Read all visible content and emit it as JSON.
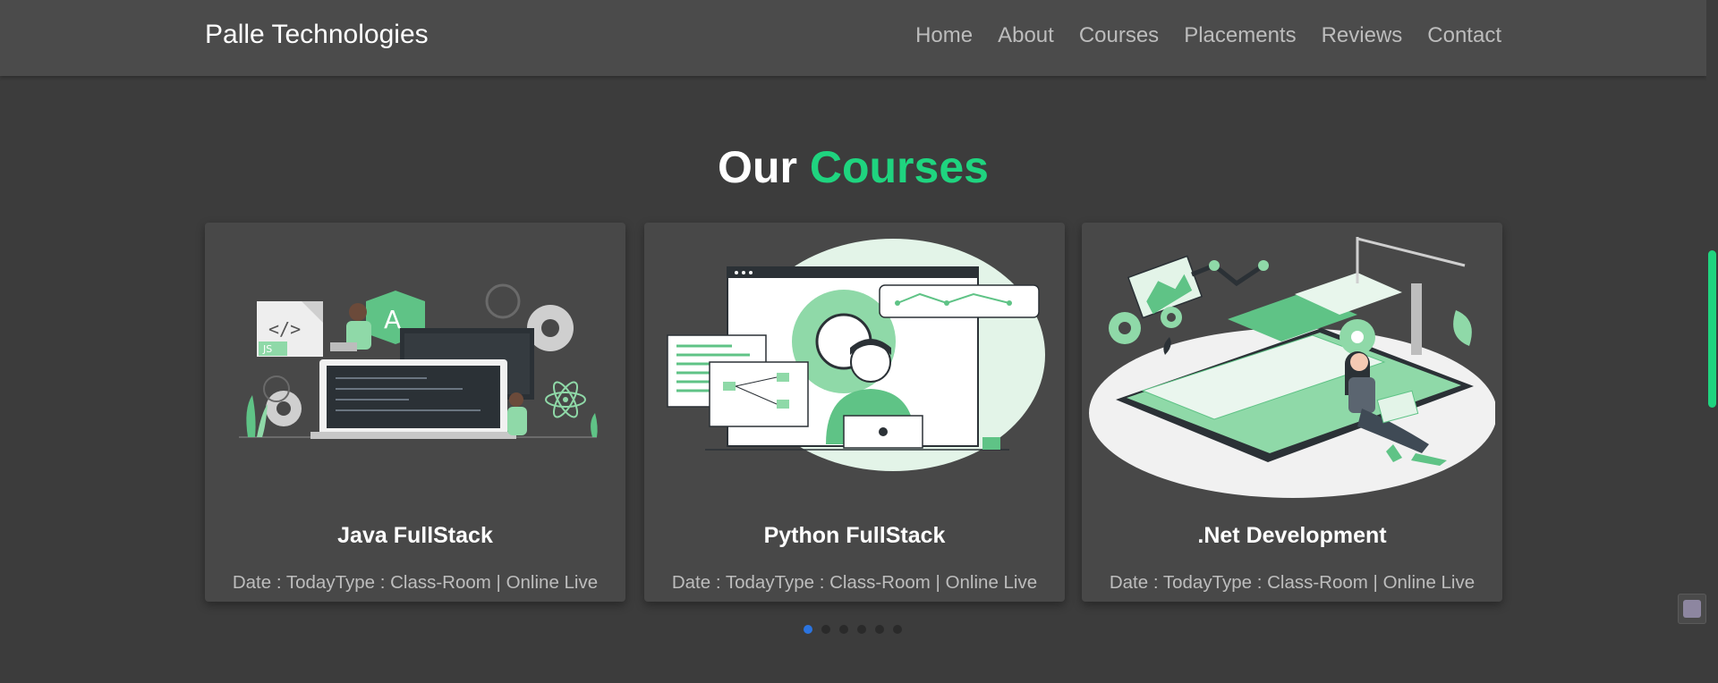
{
  "navbar": {
    "brand": "Palle Technologies",
    "links": [
      "Home",
      "About",
      "Courses",
      "Placements",
      "Reviews",
      "Contact"
    ]
  },
  "section": {
    "title_part1": "Our",
    "title_part2": "Courses"
  },
  "courses": [
    {
      "name": "Java FullStack",
      "meta": "Date : TodayType : Class-Room | Online Live",
      "illustration": "java-fullstack-illustration"
    },
    {
      "name": "Python FullStack",
      "meta": "Date : TodayType : Class-Room | Online Live",
      "illustration": "python-fullstack-illustration"
    },
    {
      "name": ".Net Development",
      "meta": "Date : TodayType : Class-Room | Online Live",
      "illustration": "dotnet-development-illustration"
    }
  ],
  "carousel": {
    "dots": 6,
    "active_index": 0
  },
  "colors": {
    "accent": "#1fd47f",
    "background": "#3c3c3c",
    "navbar": "#4b4b4b",
    "card": "#484848",
    "active_dot": "#2b74e0"
  }
}
